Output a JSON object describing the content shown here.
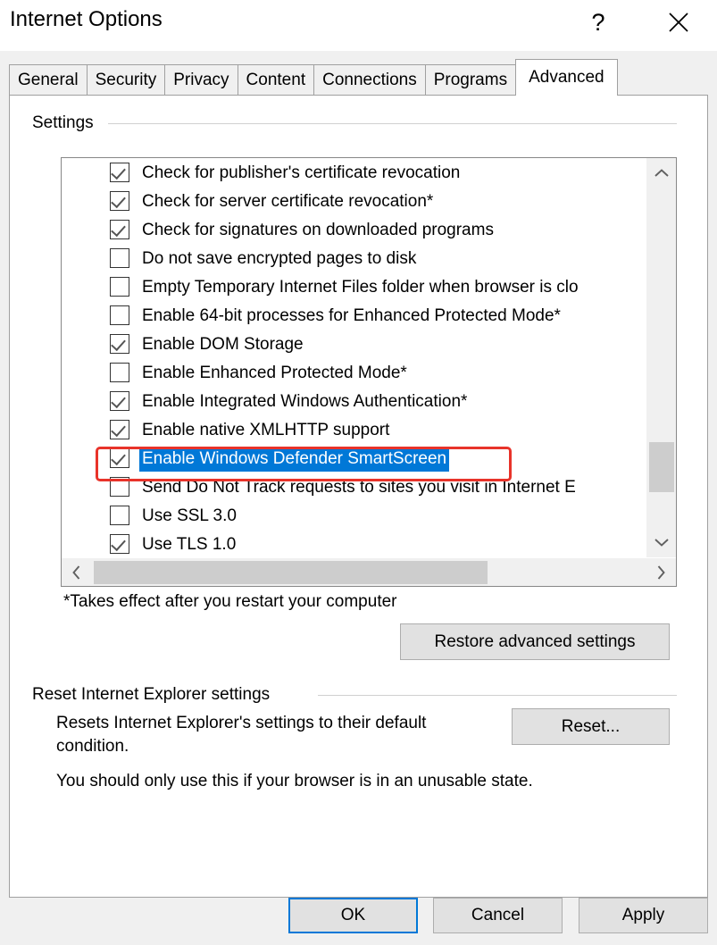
{
  "window": {
    "title": "Internet Options",
    "help_glyph": "?",
    "help_icon": "question-mark-icon",
    "close_icon": "close-icon"
  },
  "tabs": [
    {
      "label": "General",
      "active": false
    },
    {
      "label": "Security",
      "active": false
    },
    {
      "label": "Privacy",
      "active": false
    },
    {
      "label": "Content",
      "active": false
    },
    {
      "label": "Connections",
      "active": false
    },
    {
      "label": "Programs",
      "active": false
    },
    {
      "label": "Advanced",
      "active": true
    }
  ],
  "settings_group": {
    "label": "Settings",
    "items": [
      {
        "label": "Check for publisher's certificate revocation",
        "checked": true,
        "selected": false
      },
      {
        "label": "Check for server certificate revocation*",
        "checked": true,
        "selected": false
      },
      {
        "label": "Check for signatures on downloaded programs",
        "checked": true,
        "selected": false
      },
      {
        "label": "Do not save encrypted pages to disk",
        "checked": false,
        "selected": false
      },
      {
        "label": "Empty Temporary Internet Files folder when browser is clo",
        "checked": false,
        "selected": false
      },
      {
        "label": "Enable 64-bit processes for Enhanced Protected Mode*",
        "checked": false,
        "selected": false
      },
      {
        "label": "Enable DOM Storage",
        "checked": true,
        "selected": false
      },
      {
        "label": "Enable Enhanced Protected Mode*",
        "checked": false,
        "selected": false
      },
      {
        "label": "Enable Integrated Windows Authentication*",
        "checked": true,
        "selected": false
      },
      {
        "label": "Enable native XMLHTTP support",
        "checked": true,
        "selected": false
      },
      {
        "label": "Enable Windows Defender SmartScreen",
        "checked": true,
        "selected": true
      },
      {
        "label": "Send Do Not Track requests to sites you visit in Internet E",
        "checked": false,
        "selected": false
      },
      {
        "label": "Use SSL 3.0",
        "checked": false,
        "selected": false
      },
      {
        "label": "Use TLS 1.0",
        "checked": true,
        "selected": false
      }
    ],
    "scroll_up_icon": "chevron-up-icon",
    "scroll_down_icon": "chevron-down-icon",
    "scroll_left_icon": "chevron-left-icon",
    "scroll_right_icon": "chevron-right-icon"
  },
  "footnote": "*Takes effect after you restart your computer",
  "restore_button": {
    "label": "Restore advanced settings"
  },
  "reset_group": {
    "label": "Reset Internet Explorer settings",
    "description": "Resets Internet Explorer's settings to their default condition.",
    "button_label": "Reset...",
    "warning": "You should only use this if your browser is in an unusable state."
  },
  "actions": {
    "ok": "OK",
    "cancel": "Cancel",
    "apply": "Apply"
  },
  "colors": {
    "selection_blue": "#0078d7",
    "annotation_red": "#e8332a",
    "dialog_background": "#f0f0f0",
    "button_face": "#e1e1e1"
  },
  "annotation": {
    "name": "red-highlight-box",
    "target": "Enable Windows Defender SmartScreen"
  }
}
